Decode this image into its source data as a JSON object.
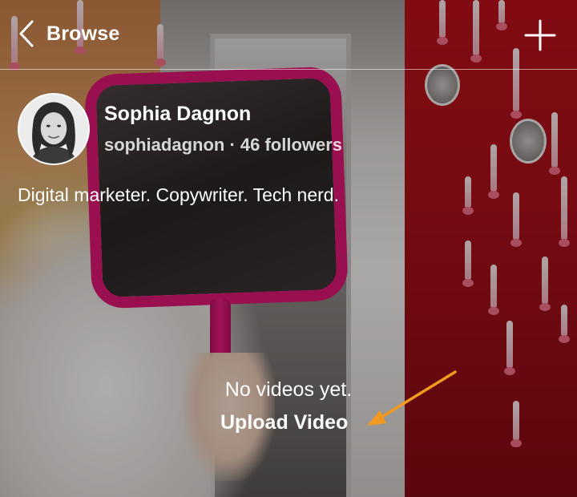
{
  "header": {
    "back_label": "Browse",
    "back_icon": "chevron-left-icon",
    "add_icon": "plus-icon"
  },
  "profile": {
    "name": "Sophia Dagnon",
    "meta": "sophiadagnon · 46 followers",
    "bio": "Digital marketer. Copywriter. Tech nerd."
  },
  "empty_state": {
    "message": "No videos yet.",
    "upload_label": "Upload Video"
  },
  "colors": {
    "text": "#ffffff",
    "annotation_arrow": "#f29a1f",
    "mirror_frame": "#d4166f",
    "right_wall": "#a5101a"
  }
}
